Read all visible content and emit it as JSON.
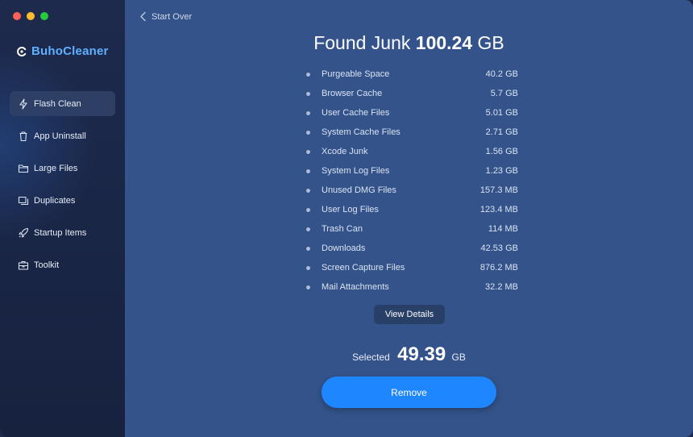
{
  "window": {
    "controls": [
      "close",
      "minimize",
      "zoom"
    ]
  },
  "sidebar": {
    "brand": "BuhoCleaner",
    "items": [
      {
        "label": "Flash Clean",
        "icon": "lightning-icon",
        "active": true
      },
      {
        "label": "App Uninstall",
        "icon": "trash-icon",
        "active": false
      },
      {
        "label": "Large Files",
        "icon": "folder-icon",
        "active": false
      },
      {
        "label": "Duplicates",
        "icon": "duplicates-icon",
        "active": false
      },
      {
        "label": "Startup Items",
        "icon": "rocket-icon",
        "active": false
      },
      {
        "label": "Toolkit",
        "icon": "toolkit-icon",
        "active": false
      }
    ]
  },
  "header": {
    "back_label": "Start Over",
    "title_prefix": "Found Junk",
    "title_value": "100.24",
    "title_unit": "GB"
  },
  "junk_items": [
    {
      "name": "Purgeable Space",
      "size": "40.2 GB"
    },
    {
      "name": "Browser Cache",
      "size": "5.7 GB"
    },
    {
      "name": "User Cache Files",
      "size": "5.01 GB"
    },
    {
      "name": "System Cache Files",
      "size": "2.71 GB"
    },
    {
      "name": "Xcode Junk",
      "size": "1.56 GB"
    },
    {
      "name": "System Log Files",
      "size": "1.23 GB"
    },
    {
      "name": "Unused DMG Files",
      "size": "157.3 MB"
    },
    {
      "name": "User Log Files",
      "size": "123.4 MB"
    },
    {
      "name": "Trash Can",
      "size": "114 MB"
    },
    {
      "name": "Downloads",
      "size": "42.53 GB"
    },
    {
      "name": "Screen Capture Files",
      "size": "876.2 MB"
    },
    {
      "name": "Mail Attachments",
      "size": "32.2 MB"
    }
  ],
  "details_button": "View Details",
  "selected": {
    "label": "Selected",
    "value": "49.39",
    "unit": "GB"
  },
  "remove_button": "Remove",
  "colors": {
    "accent": "#1e87ff",
    "brand": "#5fb0ff",
    "main_bg": "#33538a",
    "sidebar_bg": "#1d2a4d"
  }
}
